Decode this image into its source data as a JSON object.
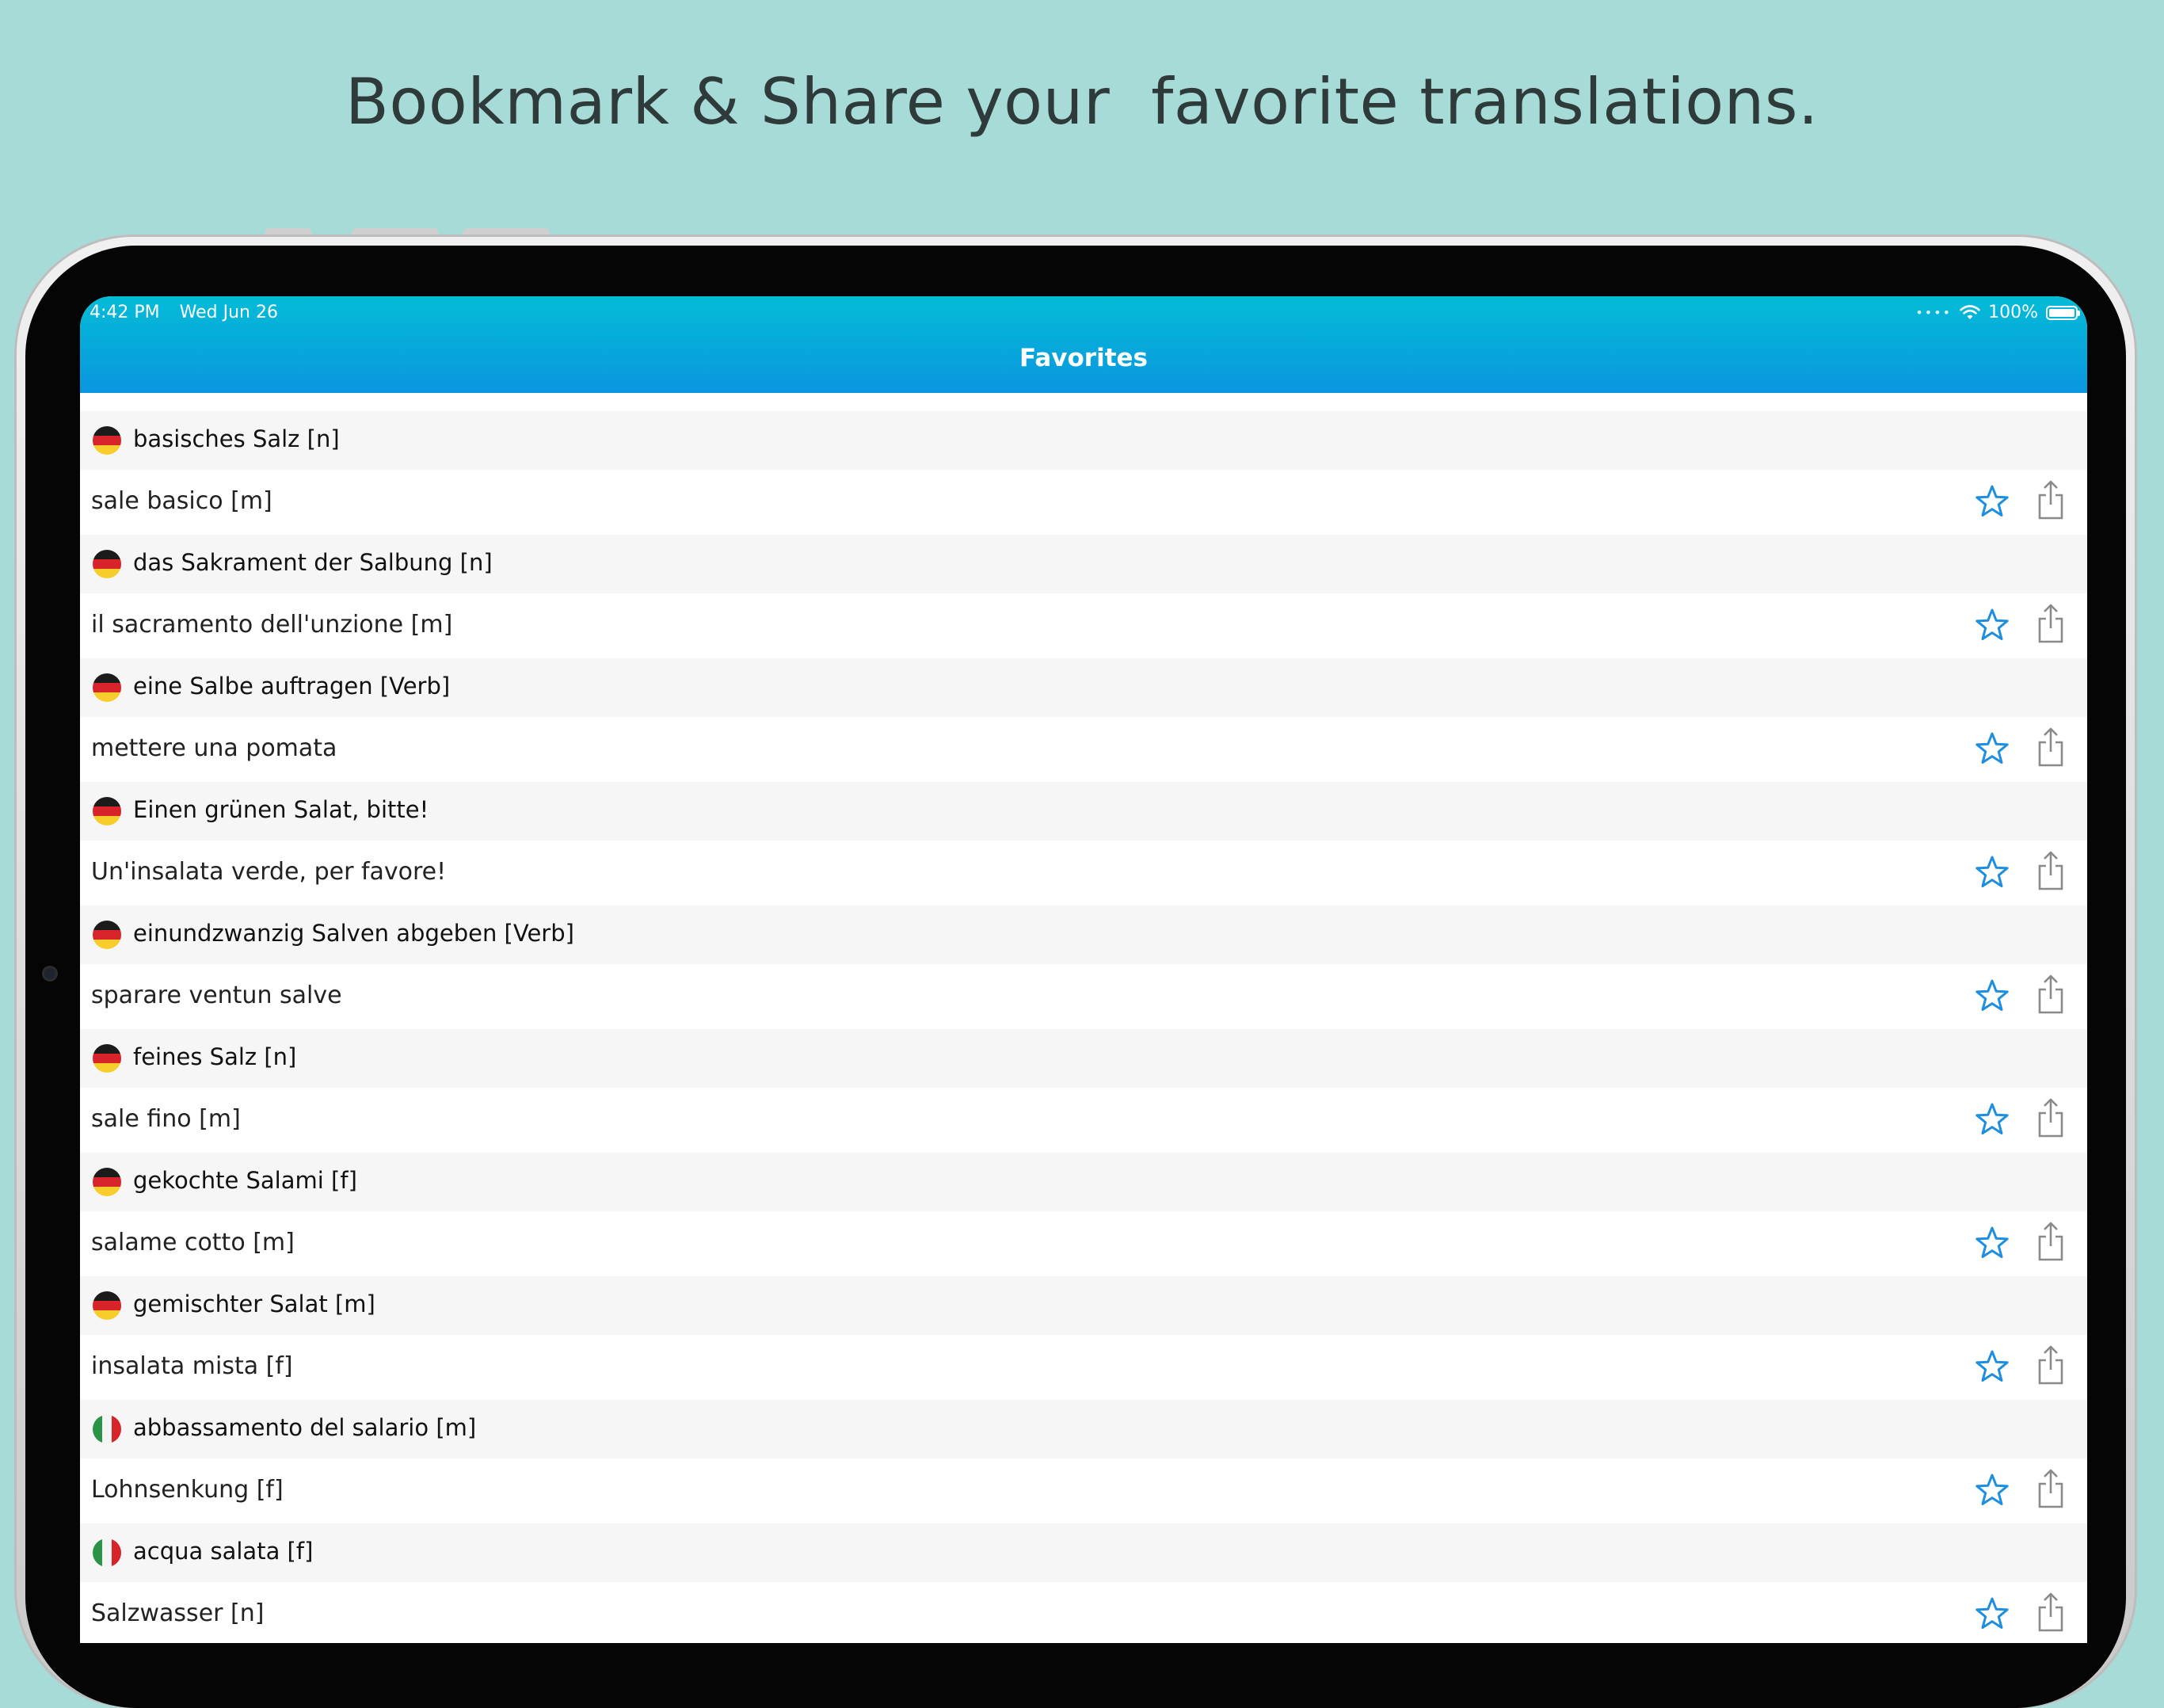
{
  "headline": "Bookmark & Share your  favorite translations.",
  "status_bar": {
    "time": "4:42 PM",
    "date": "Wed Jun 26",
    "battery": "100%"
  },
  "nav": {
    "title": "Favorites"
  },
  "entries": [
    {
      "source_lang": "de",
      "source": "basisches Salz [n]",
      "target": "sale basico [m]"
    },
    {
      "source_lang": "de",
      "source": "das Sakrament der Salbung [n]",
      "target": "il sacramento dell'unzione [m]"
    },
    {
      "source_lang": "de",
      "source": "eine Salbe auftragen [Verb]",
      "target": "mettere una pomata"
    },
    {
      "source_lang": "de",
      "source": "Einen grünen Salat, bitte!",
      "target": "Un'insalata verde, per favore!"
    },
    {
      "source_lang": "de",
      "source": "einundzwanzig Salven abgeben [Verb]",
      "target": "sparare ventun salve"
    },
    {
      "source_lang": "de",
      "source": "feines Salz [n]",
      "target": "sale fino [m]"
    },
    {
      "source_lang": "de",
      "source": "gekochte Salami [f]",
      "target": "salame cotto [m]"
    },
    {
      "source_lang": "de",
      "source": "gemischter Salat [m]",
      "target": "insalata mista [f]"
    },
    {
      "source_lang": "it",
      "source": "abbassamento del salario [m]",
      "target": "Lohnsenkung [f]"
    },
    {
      "source_lang": "it",
      "source": "acqua salata [f]",
      "target": "Salzwasser [n]"
    }
  ],
  "colors": {
    "accent": "#1e8fe0",
    "background": "#a7dbd7"
  },
  "icons": {
    "favorite": "star-outline-icon",
    "share": "share-icon"
  }
}
